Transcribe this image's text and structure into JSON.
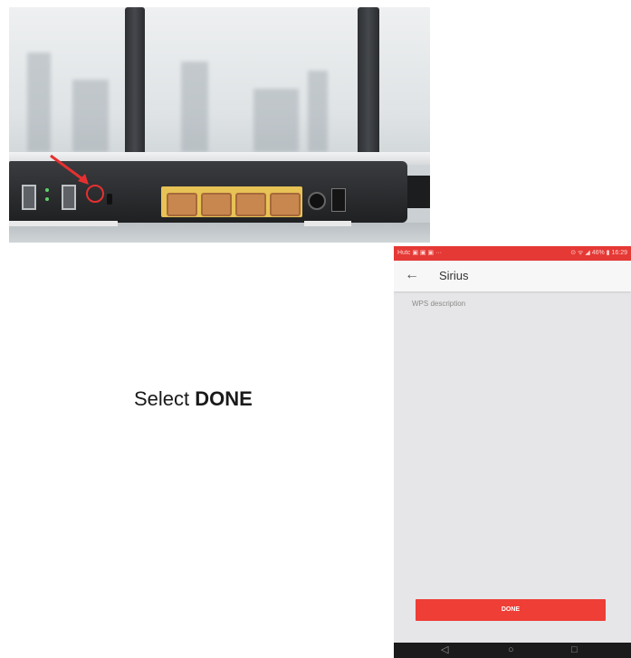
{
  "caption": {
    "prefix": "Select",
    "emphasis": "DONE"
  },
  "phone": {
    "status_left": "Hutc ▣ ▣ ▣ ···",
    "status_right": "⊙ ᯤ ◢ 46% ▮ 16:29",
    "title": "Sirius",
    "description": "WPS description",
    "done_label": "DONE",
    "accent_color": "#ee3e36",
    "icons": {
      "back": "arrow-left-icon",
      "nav_back": "triangle-back-icon",
      "nav_home": "circle-home-icon",
      "nav_recent": "square-recent-icon"
    }
  },
  "photo": {
    "highlight_color": "#e53030",
    "subject": "router-back-panel-wps-button"
  }
}
